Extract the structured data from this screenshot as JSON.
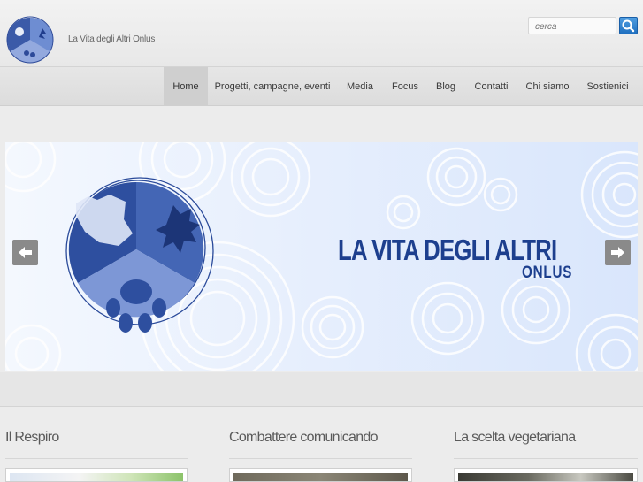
{
  "header": {
    "site_title": "La Vita degli Altri Onlus",
    "logo_icon": "paw-leaf-hand-logo",
    "search": {
      "placeholder": "cerca",
      "button_icon": "search-icon"
    }
  },
  "nav": {
    "items": [
      {
        "label": "Home",
        "active": true
      },
      {
        "label": "Progetti, campagne, eventi",
        "active": false
      },
      {
        "label": "Media",
        "active": false
      },
      {
        "label": "Focus",
        "active": false
      },
      {
        "label": "Blog",
        "active": false
      },
      {
        "label": "Contatti",
        "active": false
      },
      {
        "label": "Chi siamo",
        "active": false
      },
      {
        "label": "Sostienici",
        "active": false
      }
    ]
  },
  "banner": {
    "title": "LA VITA DEGLI ALTRI",
    "subtitle": "ONLUS",
    "prev_icon": "arrow-left-icon",
    "next_icon": "arrow-right-icon",
    "accent_color": "#1d3f8e"
  },
  "sections": [
    {
      "title": "Il Respiro"
    },
    {
      "title": "Combattere comunicando"
    },
    {
      "title": "La scelta vegetariana"
    }
  ]
}
